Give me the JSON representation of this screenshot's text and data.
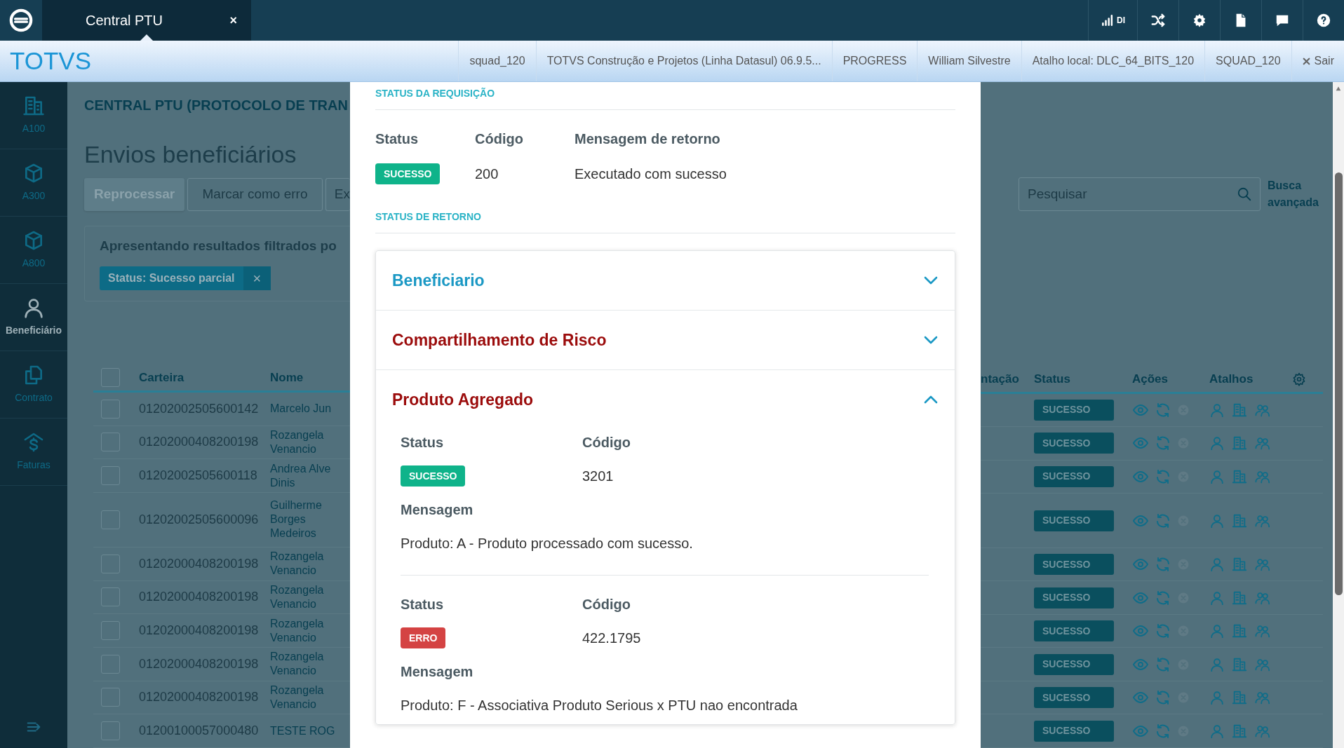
{
  "topbar": {
    "tab": {
      "label": "Central PTU",
      "close": "×",
      "selected": true
    },
    "signal_label": "DI"
  },
  "infobar": {
    "logo": "TOTVS",
    "items": [
      "squad_120",
      "TOTVS Construção e Projetos (Linha Datasul) 06.9.5...",
      "PROGRESS",
      "William Silvestre",
      "Atalho local: DLC_64_BITS_120",
      "SQUAD_120"
    ],
    "logout": "Sair"
  },
  "sidebar": {
    "items": [
      {
        "label": "A100",
        "selected": false
      },
      {
        "label": "A300",
        "selected": false
      },
      {
        "label": "A800",
        "selected": false
      },
      {
        "label": "Beneficiário",
        "selected": true
      },
      {
        "label": "Contrato",
        "selected": false
      },
      {
        "label": "Faturas",
        "selected": false
      }
    ]
  },
  "page": {
    "breadcrumb": "CENTRAL PTU (PROTOCOLO DE TRAN",
    "title": "Envios beneficiários",
    "actions": [
      {
        "label": "Reprocessar",
        "kind": "primary"
      },
      {
        "label": "Marcar como erro",
        "kind": "outline"
      },
      {
        "label": "Ex",
        "kind": "outline"
      }
    ],
    "filter_text": "Apresentando resultados filtrados po",
    "chips": [
      {
        "label": "Status: Sucesso parcial",
        "remove": "×"
      }
    ],
    "search": {
      "placeholder": "Pesquisar"
    },
    "advanced_search": "Busca avançada"
  },
  "table": {
    "columns": [
      "Carteira",
      "Nome",
      "ntação",
      "Status",
      "Ações",
      "Atalhos"
    ],
    "header_checked": false,
    "rows": [
      {
        "carteira": "01202002505600142",
        "nome": "Marcelo Jun",
        "status": "SUCESSO",
        "checked": false
      },
      {
        "carteira": "01202000408200198",
        "nome": "Rozangela\nVenancio",
        "status": "SUCESSO",
        "checked": false
      },
      {
        "carteira": "01202002505600118",
        "nome": "Andrea Alve\nDinis",
        "status": "SUCESSO",
        "checked": false
      },
      {
        "carteira": "01202002505600096",
        "nome": "Guilherme\nBorges\nMedeiros",
        "status": "SUCESSO",
        "checked": false
      },
      {
        "carteira": "01202000408200198",
        "nome": "Rozangela\nVenancio",
        "status": "SUCESSO",
        "checked": false
      },
      {
        "carteira": "01202000408200198",
        "nome": "Rozangela\nVenancio",
        "status": "SUCESSO",
        "checked": false
      },
      {
        "carteira": "01202000408200198",
        "nome": "Rozangela\nVenancio",
        "status": "SUCESSO",
        "checked": false
      },
      {
        "carteira": "01202000408200198",
        "nome": "Rozangela\nVenancio",
        "status": "SUCESSO",
        "checked": false
      },
      {
        "carteira": "01202000408200198",
        "nome": "Rozangela\nVenancio",
        "status": "SUCESSO",
        "checked": false
      },
      {
        "carteira": "01200100057000480",
        "nome": "TESTE ROG",
        "status": "SUCESSO",
        "checked": false
      }
    ]
  },
  "modal": {
    "request_section": "STATUS DA REQUISIÇÃO",
    "request": {
      "labels": [
        "Status",
        "Código",
        "Mensagem de retorno"
      ],
      "status": {
        "label": "SUCESSO",
        "kind": "success"
      },
      "code": "200",
      "message": "Executado com sucesso"
    },
    "return_section": "STATUS DE RETORNO",
    "accordion": [
      {
        "title": "Beneficiario",
        "color": "#1a98c4",
        "expanded": false
      },
      {
        "title": "Compartilhamento de Risco",
        "color": "#9b0b0b",
        "expanded": false
      },
      {
        "title": "Produto Agregado",
        "color": "#9b0b0b",
        "expanded": true,
        "results": [
          {
            "status_label": "Status",
            "code_label": "Código",
            "status": {
              "label": "SUCESSO",
              "kind": "success"
            },
            "code": "3201",
            "message_label": "Mensagem",
            "message": "Produto: A - Produto processado com sucesso."
          },
          {
            "status_label": "Status",
            "code_label": "Código",
            "status": {
              "label": "ERRO",
              "kind": "error"
            },
            "code": "422.1795",
            "message_label": "Mensagem",
            "message": "Produto: F - Associativa Produto Serious x PTU nao encontrada"
          }
        ]
      }
    ]
  }
}
